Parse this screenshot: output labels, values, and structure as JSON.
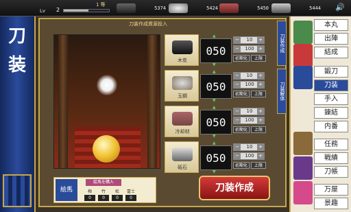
{
  "top": {
    "level_label": "Lv",
    "level": "2",
    "exp_fraction": 0.55,
    "rank": "1 等",
    "resources": [
      {
        "icon": "charcoal-icon",
        "value": "5374"
      },
      {
        "icon": "tamahagane-icon",
        "value": "5424"
      },
      {
        "icon": "coolant-icon",
        "value": "5450"
      },
      {
        "icon": "whetstone-icon",
        "value": "5444"
      }
    ]
  },
  "banner": {
    "char1": "刀",
    "char2": "装"
  },
  "panel": {
    "title": "刀装作成資源投入"
  },
  "rows": [
    {
      "name": "木炭",
      "amount": "050",
      "step1": "10",
      "step2": "100",
      "init": "初期化",
      "max": "上限"
    },
    {
      "name": "玉鋼",
      "amount": "050",
      "step1": "10",
      "step2": "100",
      "init": "初期化",
      "max": "上限"
    },
    {
      "name": "冷却材",
      "amount": "050",
      "step1": "10",
      "step2": "100",
      "init": "初期化",
      "max": "上限"
    },
    {
      "name": "砥石",
      "amount": "050",
      "step1": "10",
      "step2": "100",
      "init": "初期化",
      "max": "上限"
    }
  ],
  "craft_button": "刀装作成",
  "ema": {
    "icon_label": "絵馬",
    "buy_label": "絵馬を購入",
    "types": [
      "梅",
      "竹",
      "松",
      "富士"
    ],
    "counts": [
      "0",
      "0",
      "0",
      "0"
    ]
  },
  "vtabs": [
    "刀装作成",
    "刀装解体"
  ],
  "menu": [
    {
      "label": "本丸",
      "active": false
    },
    {
      "label": "出陣",
      "active": false
    },
    {
      "label": "結成",
      "active": false
    },
    {
      "label": "鍛刀",
      "active": false
    },
    {
      "label": "刀装",
      "active": true
    },
    {
      "label": "手入",
      "active": false
    },
    {
      "label": "錬結",
      "active": false
    },
    {
      "label": "内番",
      "active": false
    },
    {
      "label": "任務",
      "active": false
    },
    {
      "label": "戦績",
      "active": false
    },
    {
      "label": "刀帳",
      "active": false
    },
    {
      "label": "万屋",
      "active": false
    },
    {
      "label": "景趣",
      "active": false
    }
  ]
}
